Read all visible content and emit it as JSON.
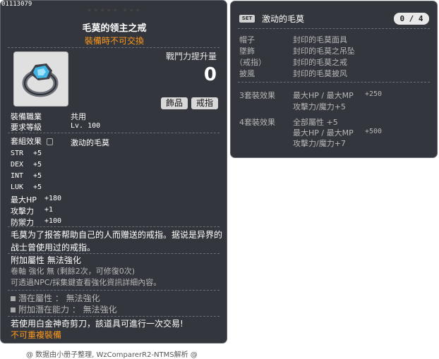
{
  "item": {
    "id": "01113079",
    "stars": "★★★★★ ★★★",
    "name": "毛莫的领主之戒",
    "trade_note": "裝備時不可交換",
    "power_label": "戰鬥力提升量",
    "power_value": "0",
    "categories": [
      "飾品",
      "戒指"
    ],
    "job_label": "裝備職業",
    "job_value": "共用",
    "req_level_label": "要求等級",
    "req_level_value": "Lv. 100",
    "set_effect_label": "套組效果",
    "set_effect_name": "激动的毛莫",
    "stats": [
      {
        "name": "STR",
        "value": "+5"
      },
      {
        "name": "DEX",
        "value": "+5"
      },
      {
        "name": "INT",
        "value": "+5"
      },
      {
        "name": "LUK",
        "value": "+5"
      },
      {
        "name": "最大HP",
        "value": "+180"
      },
      {
        "name": "攻擊力",
        "value": "+1"
      },
      {
        "name": "防禦力",
        "value": "+100"
      }
    ],
    "description": "毛莫为了报答帮助自己的人而赠送的戒指。据说是异界的战士曾使用过的戒指。",
    "extra_attr": "附加屬性  無法強化",
    "scroll_line": "卷軸 強化 無 (剩餘2次，可修復0次)",
    "hint_line": "可透過NPC/採集鍵查看強化資訊詳細內容。",
    "potential": "潛在屬性 ： 無法強化",
    "add_potential": "附加潛在能力 ： 無法強化",
    "scissors_note": "若使用白金神奇剪刀，該道具可進行一次交易!",
    "no_dup": "不可重複裝備"
  },
  "set": {
    "badge": "SET",
    "title": "激动的毛莫",
    "count": "0 / 4",
    "pieces": [
      {
        "slot": "帽子",
        "name": "封印的毛莫面具"
      },
      {
        "slot": "墜飾",
        "name": "封印的毛莫之吊坠"
      },
      {
        "slot": "（戒指）",
        "name": "封印的毛莫之戒"
      },
      {
        "slot": "披風",
        "name": "封印的毛莫披风"
      }
    ],
    "effect3_label": "3套裝效果",
    "effect3": [
      {
        "name": "最大HP / 最大MP",
        "value": "+250"
      },
      {
        "name": "攻擊力/魔力+5",
        "value": ""
      }
    ],
    "effect4_label": "4套裝效果",
    "effect4": [
      {
        "name": "全部屬性 +5",
        "value": ""
      },
      {
        "name": "最大HP / 最大MP",
        "value": "+500"
      },
      {
        "name": "攻擊力/魔力+7",
        "value": ""
      }
    ]
  },
  "footer": "@ 数据由小册子整理, WzComparerR2-NTMS解析 @"
}
